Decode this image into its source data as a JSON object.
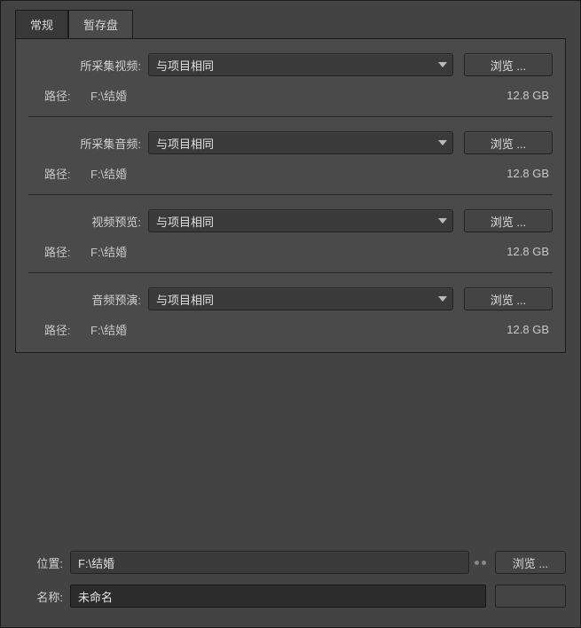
{
  "tabs": {
    "general": "常规",
    "scratch": "暂存盘"
  },
  "sections": [
    {
      "label": "所采集视频:",
      "dropdown": "与项目相同",
      "browse": "浏览 ...",
      "pathLabel": "路径:",
      "pathValue": "F:\\结婚",
      "size": "12.8 GB"
    },
    {
      "label": "所采集音频:",
      "dropdown": "与项目相同",
      "browse": "浏览 ...",
      "pathLabel": "路径:",
      "pathValue": "F:\\结婚",
      "size": "12.8 GB"
    },
    {
      "label": "视频预览:",
      "dropdown": "与项目相同",
      "browse": "浏览 ...",
      "pathLabel": "路径:",
      "pathValue": "F:\\结婚",
      "size": "12.8 GB"
    },
    {
      "label": "音频预演:",
      "dropdown": "与项目相同",
      "browse": "浏览 ...",
      "pathLabel": "路径:",
      "pathValue": "F:\\结婚",
      "size": "12.8 GB"
    }
  ],
  "bottom": {
    "locationLabel": "位置:",
    "locationValue": "F:\\结婚",
    "browse": "浏览 ...",
    "nameLabel": "名称:",
    "nameValue": "未命名"
  }
}
